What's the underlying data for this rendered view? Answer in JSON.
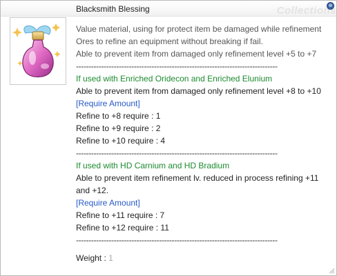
{
  "window": {
    "title": "Blacksmith Blessing",
    "watermark": "Collections",
    "close_glyph": "⊗"
  },
  "item_image": {
    "icon": "potion-bottle-icon"
  },
  "description": {
    "intro_1": "Value material, using for protect item be damaged while refinement",
    "intro_2": "Ores to refine an equipment without breaking if fail.",
    "intro_3": "Able to prevent item from damaged only refinement level +5 to +7",
    "separator": "--------------------------------------------------------------------------------",
    "section1": {
      "heading": "If used with Enriched Oridecon and Enriched Elunium",
      "text": "Able to prevent item from damaged only refinement level +8 to +10",
      "require_label": "[Require Amount]",
      "rows": [
        "Refine to +8 require : 1",
        "Refine to +9 require : 2",
        "Refine to +10 require : 4"
      ]
    },
    "section2": {
      "heading": "If used with HD Carnium and HD Bradium",
      "text_1": "Able to prevent item refinement lv. reduced in process refining +11",
      "text_2": "and +12.",
      "require_label": "[Require Amount]",
      "rows": [
        "Refine to +11 require : 7",
        "Refine to +12 require : 11"
      ]
    },
    "weight_label": "Weight : ",
    "weight_value": "1"
  },
  "colors": {
    "heading_green": "#1b8a2e",
    "link_blue": "#2659c7",
    "weight_gray": "#a9a9a9"
  }
}
